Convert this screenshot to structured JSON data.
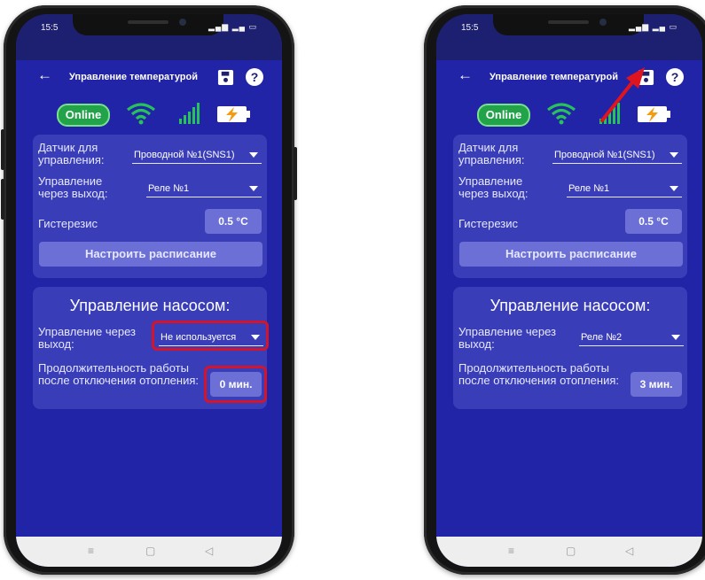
{
  "status_bar": {
    "time": "15:5",
    "signal": "▂▄▆ ▂▄ ▭"
  },
  "app_bar": {
    "back_icon": "←",
    "title": "Управление температурой",
    "help_icon": "?"
  },
  "connection": {
    "online_label": "Online"
  },
  "colors": {
    "screen_bg": "#2124a6",
    "card_bg": "#3a3db8",
    "button_bg": "#6b6fd6",
    "highlight": "#d4142b",
    "online": "#22a34a"
  },
  "nav_bar": {
    "recents": "≡",
    "home": "▢",
    "back": "◁"
  },
  "phones": [
    {
      "thermo": {
        "sensor_label": "Датчик для управления:",
        "sensor_value": "Проводной №1(SNS1)",
        "output_label": "Управление через выход:",
        "output_value": "Реле №1",
        "hysteresis_label": "Гистерезис",
        "hysteresis_value": "0.5 °C",
        "schedule_button": "Настроить расписание"
      },
      "pump": {
        "title": "Управление насосом:",
        "output_label": "Управление через выход:",
        "output_value": "Не используется",
        "duration_label": "Продолжительность работы после отключения отопления:",
        "duration_value": "0 мин."
      }
    },
    {
      "thermo": {
        "sensor_label": "Датчик для управления:",
        "sensor_value": "Проводной №1(SNS1)",
        "output_label": "Управление через выход:",
        "output_value": "Реле №1",
        "hysteresis_label": "Гистерезис",
        "hysteresis_value": "0.5 °C",
        "schedule_button": "Настроить расписание"
      },
      "pump": {
        "title": "Управление насосом:",
        "output_label": "Управление через выход:",
        "output_value": "Реле №2",
        "duration_label": "Продолжительность работы после отключения отопления:",
        "duration_value": "3 мин."
      }
    }
  ]
}
